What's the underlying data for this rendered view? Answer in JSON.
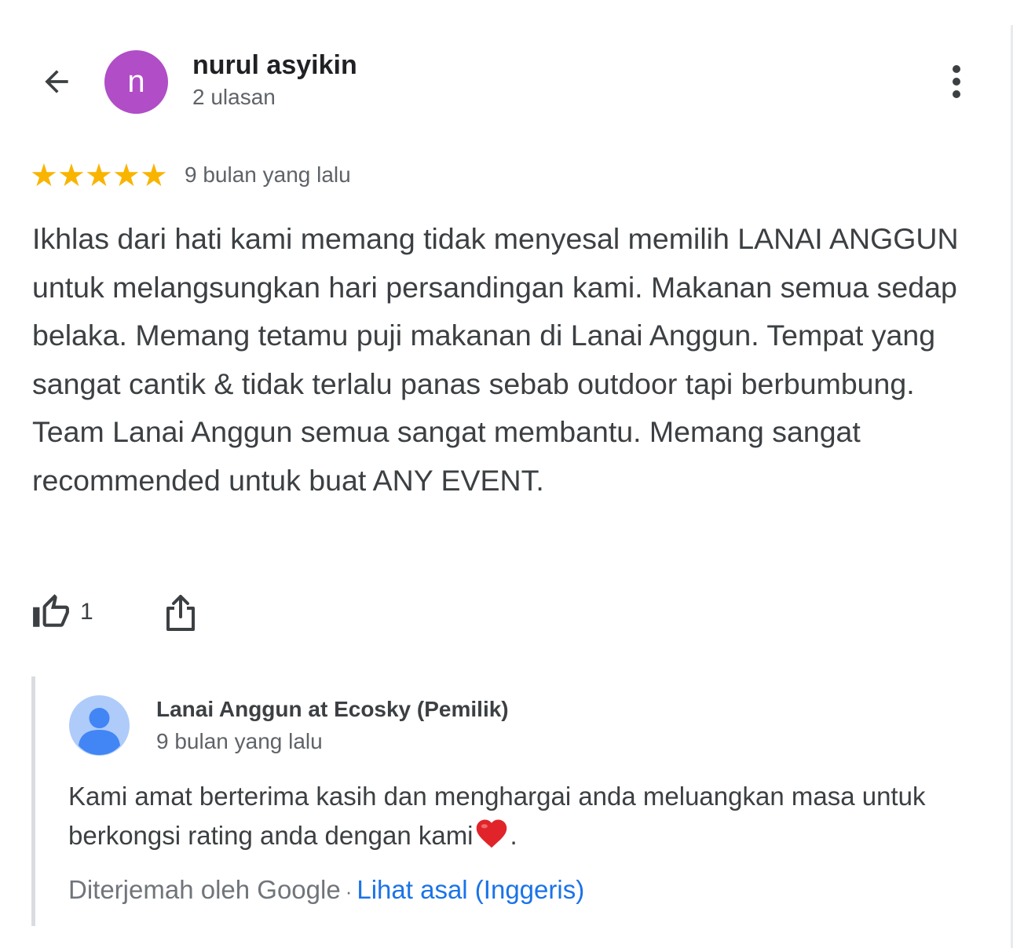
{
  "header": {
    "back_icon": "arrow-back-icon",
    "avatar_letter": "n",
    "avatar_color": "#b04dc7",
    "reviewer_name": "nurul asyikin",
    "review_count": "2 ulasan",
    "more_icon": "more-vert-icon"
  },
  "review": {
    "rating": 5,
    "max_rating": 5,
    "star_color": "#f9b400",
    "time_ago": "9 bulan yang lalu",
    "text": "Ikhlas dari hati kami memang tidak menyesal memilih LANAI ANGGUN untuk melangsungkan hari persandingan kami. Makanan semua sedap belaka. Memang tetamu puji makanan di Lanai Anggun. Tempat yang sangat cantik & tidak terlalu panas sebab outdoor tapi berbumbung. Team Lanai Anggun semua sangat membantu. Memang sangat recommended untuk buat ANY EVENT."
  },
  "actions": {
    "like_icon": "thumb-up-outline-icon",
    "like_count": "1",
    "share_icon": "share-icon"
  },
  "owner_reply": {
    "avatar_icon": "default-person-avatar-icon",
    "name": "Lanai Anggun at Ecosky (Pemilik)",
    "time_ago": "9 bulan yang lalu",
    "text_before_heart": "Kami amat berterima kasih dan menghargai anda meluangkan masa untuk berkongsi rating anda dengan kami",
    "heart_icon": "red-heart-emoji-icon",
    "text_after_heart": ".",
    "translated_label": "Diterjemah oleh Google",
    "separator": "·",
    "see_original_link": "Lihat asal (Inggeris)",
    "link_color": "#1a73e8"
  }
}
